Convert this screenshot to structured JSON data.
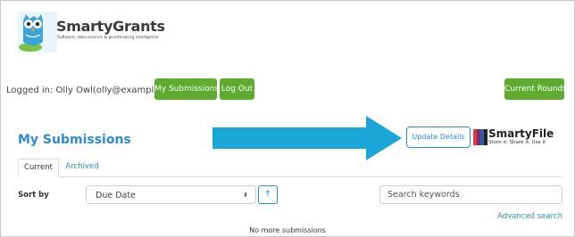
{
  "brand": {
    "name": "SmartyGrants",
    "tagline": "Software, data science & grantmaking intelligence"
  },
  "session": {
    "logged_in_text": "Logged in: Olly Owl(olly@example.com)",
    "my_submissions_label": "My Submissions",
    "logout_label": "Log Out",
    "current_rounds_label": "Current Rounds"
  },
  "page": {
    "title": "My Submissions",
    "update_details_label": "Update Details",
    "smartyfile": {
      "name": "SmartyFile",
      "tagline": "Store it; Share it; Use it"
    }
  },
  "tabs": [
    {
      "label": "Current",
      "active": true
    },
    {
      "label": "Archived",
      "active": false
    }
  ],
  "filters": {
    "sort_label": "Sort by",
    "sort_value": "Due Date",
    "sort_direction_icon": "↑",
    "search_placeholder": "Search keywords",
    "advanced_search_label": "Advanced search"
  },
  "results": {
    "empty_message": "No more submissions"
  },
  "colors": {
    "accent": "#2e8bd8",
    "green": "#5fab2f",
    "arrow": "#1aa6d6"
  }
}
